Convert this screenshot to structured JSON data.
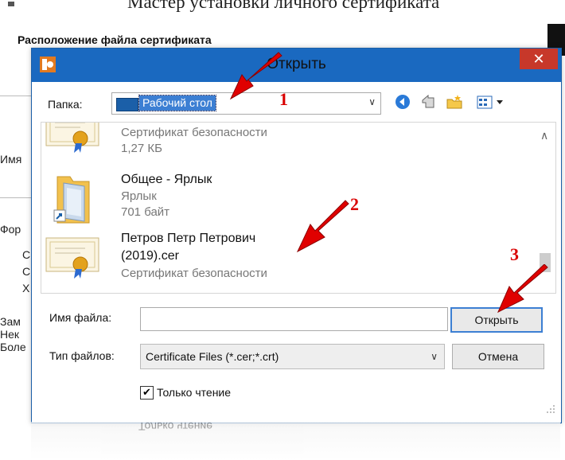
{
  "background": {
    "title": "Мастер установки личного сертификата",
    "section_title": "Расположение файла сертификата",
    "labels": [
      "Имя",
      "Фор",
      "С",
      "С",
      "Х",
      "Зам",
      "Нек",
      "Боле"
    ]
  },
  "dialog": {
    "title": "Открыть",
    "close_label": "✕",
    "folder_label": "Папка:",
    "folder_value": "Рабочий стол",
    "files": [
      {
        "name": "",
        "type": "Сертификат безопасности",
        "size": "1,27 КБ",
        "icon": "certificate-icon"
      },
      {
        "name": "Общее - Ярлык",
        "type": "Ярлык",
        "size": "701 байт",
        "icon": "folder-shortcut-icon"
      },
      {
        "name_line1": "Петров Петр Петрович",
        "name_line2": "(2019).cer",
        "type": "Сертификат безопасности",
        "icon": "certificate-icon"
      }
    ],
    "filename_label": "Имя файла:",
    "filename_value": "",
    "filetype_label": "Тип файлов:",
    "filetype_value": "Certificate Files (*.cer;*.crt)",
    "open_button": "Открыть",
    "cancel_button": "Отмена",
    "readonly_label": "Только чтение",
    "readonly_checked": "✔"
  },
  "reflection": {
    "text": "Только чтение"
  },
  "annotations": {
    "n1": "1",
    "n2": "2",
    "n3": "3",
    "color": "#e00000"
  },
  "colors": {
    "titlebar": "#1a69c0",
    "close": "#c7382a",
    "selection": "#3c7fd3"
  }
}
